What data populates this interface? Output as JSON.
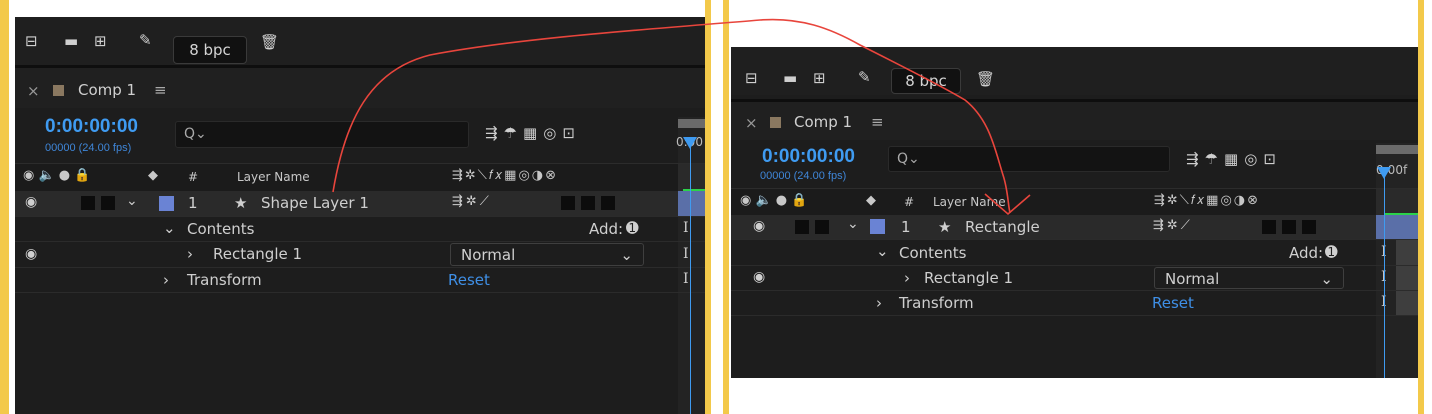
{
  "colors": {
    "frame": "#f3c94a",
    "panel_bg": "#1d1d1d",
    "timecode": "#3f9bf1",
    "label_blue": "#6a83d4",
    "reset": "#3f8fe6",
    "annotation": "#e8453c"
  },
  "left": {
    "bpc": "8 bpc",
    "comp_tab": "Comp 1",
    "close": "×",
    "menu": "≡",
    "timecode": "0:00:00:00",
    "frames": "00000 (24.00 fps)",
    "search_placeholder": "Q⌄",
    "ruler_tick": "0:00",
    "header": {
      "num": "#",
      "layer_name": "Layer Name"
    },
    "layer": {
      "index": "1",
      "star": "★",
      "name": "Shape Layer 1"
    },
    "contents": "Contents",
    "add": "Add:",
    "rect": "Rectangle 1",
    "blend_mode": "Normal",
    "transform": "Transform",
    "reset": "Reset"
  },
  "right": {
    "bpc": "8 bpc",
    "comp_tab": "Comp 1",
    "close": "×",
    "menu": "≡",
    "timecode": "0:00:00:00",
    "frames": "00000 (24.00 fps)",
    "search_placeholder": "Q⌄",
    "ruler_tick": "0:00f",
    "header": {
      "num": "#",
      "layer_name": "Layer Name"
    },
    "layer": {
      "index": "1",
      "star": "★",
      "name": "Rectangle"
    },
    "contents": "Contents",
    "add": "Add:",
    "rect": "Rectangle 1",
    "blend_mode": "Normal",
    "transform": "Transform",
    "reset": "Reset"
  },
  "icons": [
    "project-flowchart-icon",
    "folder-icon",
    "composition-icon",
    "brush-icon",
    "trash-icon",
    "eye-icon",
    "audio-icon",
    "solo-icon",
    "lock-icon",
    "label-icon",
    "shy-icon",
    "draft-3d-icon",
    "motion-blur-icon",
    "graph-editor-icon",
    "twirl-down-icon",
    "add-circle-icon",
    "chevron-down-icon",
    "ibeam-icon"
  ]
}
